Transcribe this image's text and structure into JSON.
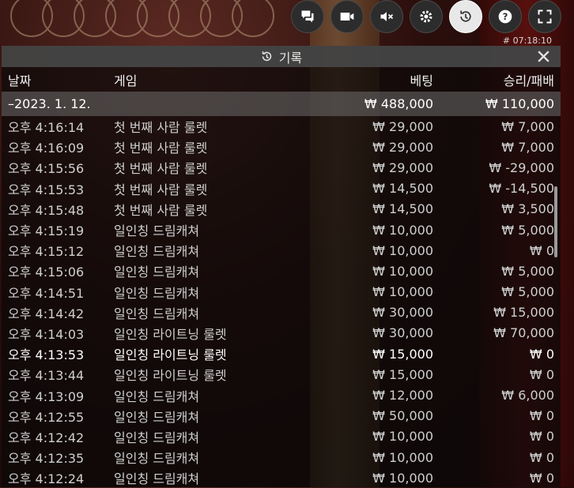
{
  "toolbar": {
    "icons": [
      "chat-icon",
      "video-icon",
      "mute-icon",
      "settings-icon",
      "history-icon",
      "help-icon",
      "fullscreen-icon"
    ],
    "clock": "# 07:18:10"
  },
  "panel": {
    "title": "기록",
    "columns": {
      "date": "날짜",
      "game": "게임",
      "bet": "베팅",
      "winloss": "승리/패배"
    },
    "date_row": {
      "date": "–2023. 1. 12.",
      "bet": "₩ 488,000",
      "winloss": "₩ 110,000"
    },
    "rows": [
      {
        "time": "오후 4:16:14",
        "game": "첫 번째 사람 룰렛",
        "bet": "₩ 29,000",
        "winloss": "₩ 7,000"
      },
      {
        "time": "오후 4:16:09",
        "game": "첫 번째 사람 룰렛",
        "bet": "₩ 29,000",
        "winloss": "₩ 7,000"
      },
      {
        "time": "오후 4:15:56",
        "game": "첫 번째 사람 룰렛",
        "bet": "₩ 29,000",
        "winloss": "₩ -29,000"
      },
      {
        "time": "오후 4:15:53",
        "game": "첫 번째 사람 룰렛",
        "bet": "₩ 14,500",
        "winloss": "₩ -14,500"
      },
      {
        "time": "오후 4:15:48",
        "game": "첫 번째 사람 룰렛",
        "bet": "₩ 14,500",
        "winloss": "₩ 3,500"
      },
      {
        "time": "오후 4:15:19",
        "game": "일인칭 드림캐쳐",
        "bet": "₩ 10,000",
        "winloss": "₩ 5,000"
      },
      {
        "time": "오후 4:15:12",
        "game": "일인칭 드림캐쳐",
        "bet": "₩ 10,000",
        "winloss": "₩ 0"
      },
      {
        "time": "오후 4:15:06",
        "game": "일인칭 드림캐쳐",
        "bet": "₩ 10,000",
        "winloss": "₩ 5,000"
      },
      {
        "time": "오후 4:14:51",
        "game": "일인칭 드림캐쳐",
        "bet": "₩ 10,000",
        "winloss": "₩ 5,000"
      },
      {
        "time": "오후 4:14:42",
        "game": "일인칭 드림캐쳐",
        "bet": "₩ 30,000",
        "winloss": "₩ 15,000"
      },
      {
        "time": "오후 4:14:03",
        "game": "일인칭 라이트닝 룰렛",
        "bet": "₩ 30,000",
        "winloss": "₩ 70,000"
      },
      {
        "time": "오후 4:13:53",
        "game": "일인칭 라이트닝 룰렛",
        "bet": "₩ 15,000",
        "winloss": "₩ 0"
      },
      {
        "time": "오후 4:13:44",
        "game": "일인칭 라이트닝 룰렛",
        "bet": "₩ 15,000",
        "winloss": "₩ 0"
      },
      {
        "time": "오후 4:13:09",
        "game": "일인칭 드림캐쳐",
        "bet": "₩ 12,000",
        "winloss": "₩ 6,000"
      },
      {
        "time": "오후 4:12:55",
        "game": "일인칭 드림캐쳐",
        "bet": "₩ 50,000",
        "winloss": "₩ 0"
      },
      {
        "time": "오후 4:12:42",
        "game": "일인칭 드림캐쳐",
        "bet": "₩ 10,000",
        "winloss": "₩ 0"
      },
      {
        "time": "오후 4:12:35",
        "game": "일인칭 드림캐쳐",
        "bet": "₩ 10,000",
        "winloss": "₩ 0"
      },
      {
        "time": "오후 4:12:24",
        "game": "일인칭 드림캐쳐",
        "bet": "₩ 10,000",
        "winloss": "₩ 0"
      }
    ]
  }
}
